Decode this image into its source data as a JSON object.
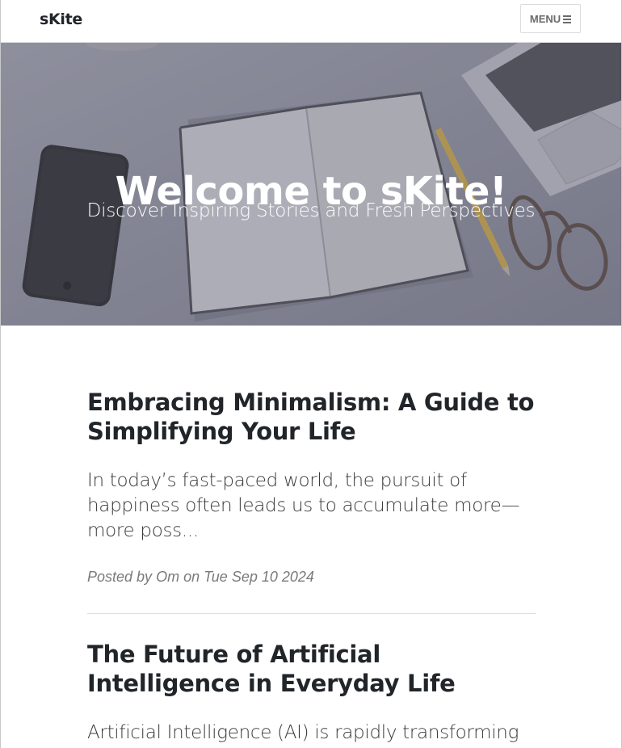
{
  "navbar": {
    "brand": "sKite",
    "menu_label": "MENU"
  },
  "hero": {
    "title": "Welcome to sKite!",
    "subtitle": "Discover Inspiring Stories and Fresh Perspectives"
  },
  "posts": [
    {
      "title": "Embracing Minimalism: A Guide to Simplifying Your Life",
      "excerpt": "In today’s fast-paced world, the pursuit of happiness often leads us to accumulate more—more poss...",
      "meta_prefix": "Posted by",
      "author": "Om",
      "meta_on": "on",
      "date": "Tue Sep 10 2024"
    },
    {
      "title": "The Future of Artificial Intelligence in Everyday Life",
      "excerpt": "Artificial Intelligence (AI) is rapidly transforming"
    }
  ],
  "colors": {
    "text": "#212529",
    "meta": "#7a7a7a",
    "hero_overlay": "#8a8c9a"
  }
}
